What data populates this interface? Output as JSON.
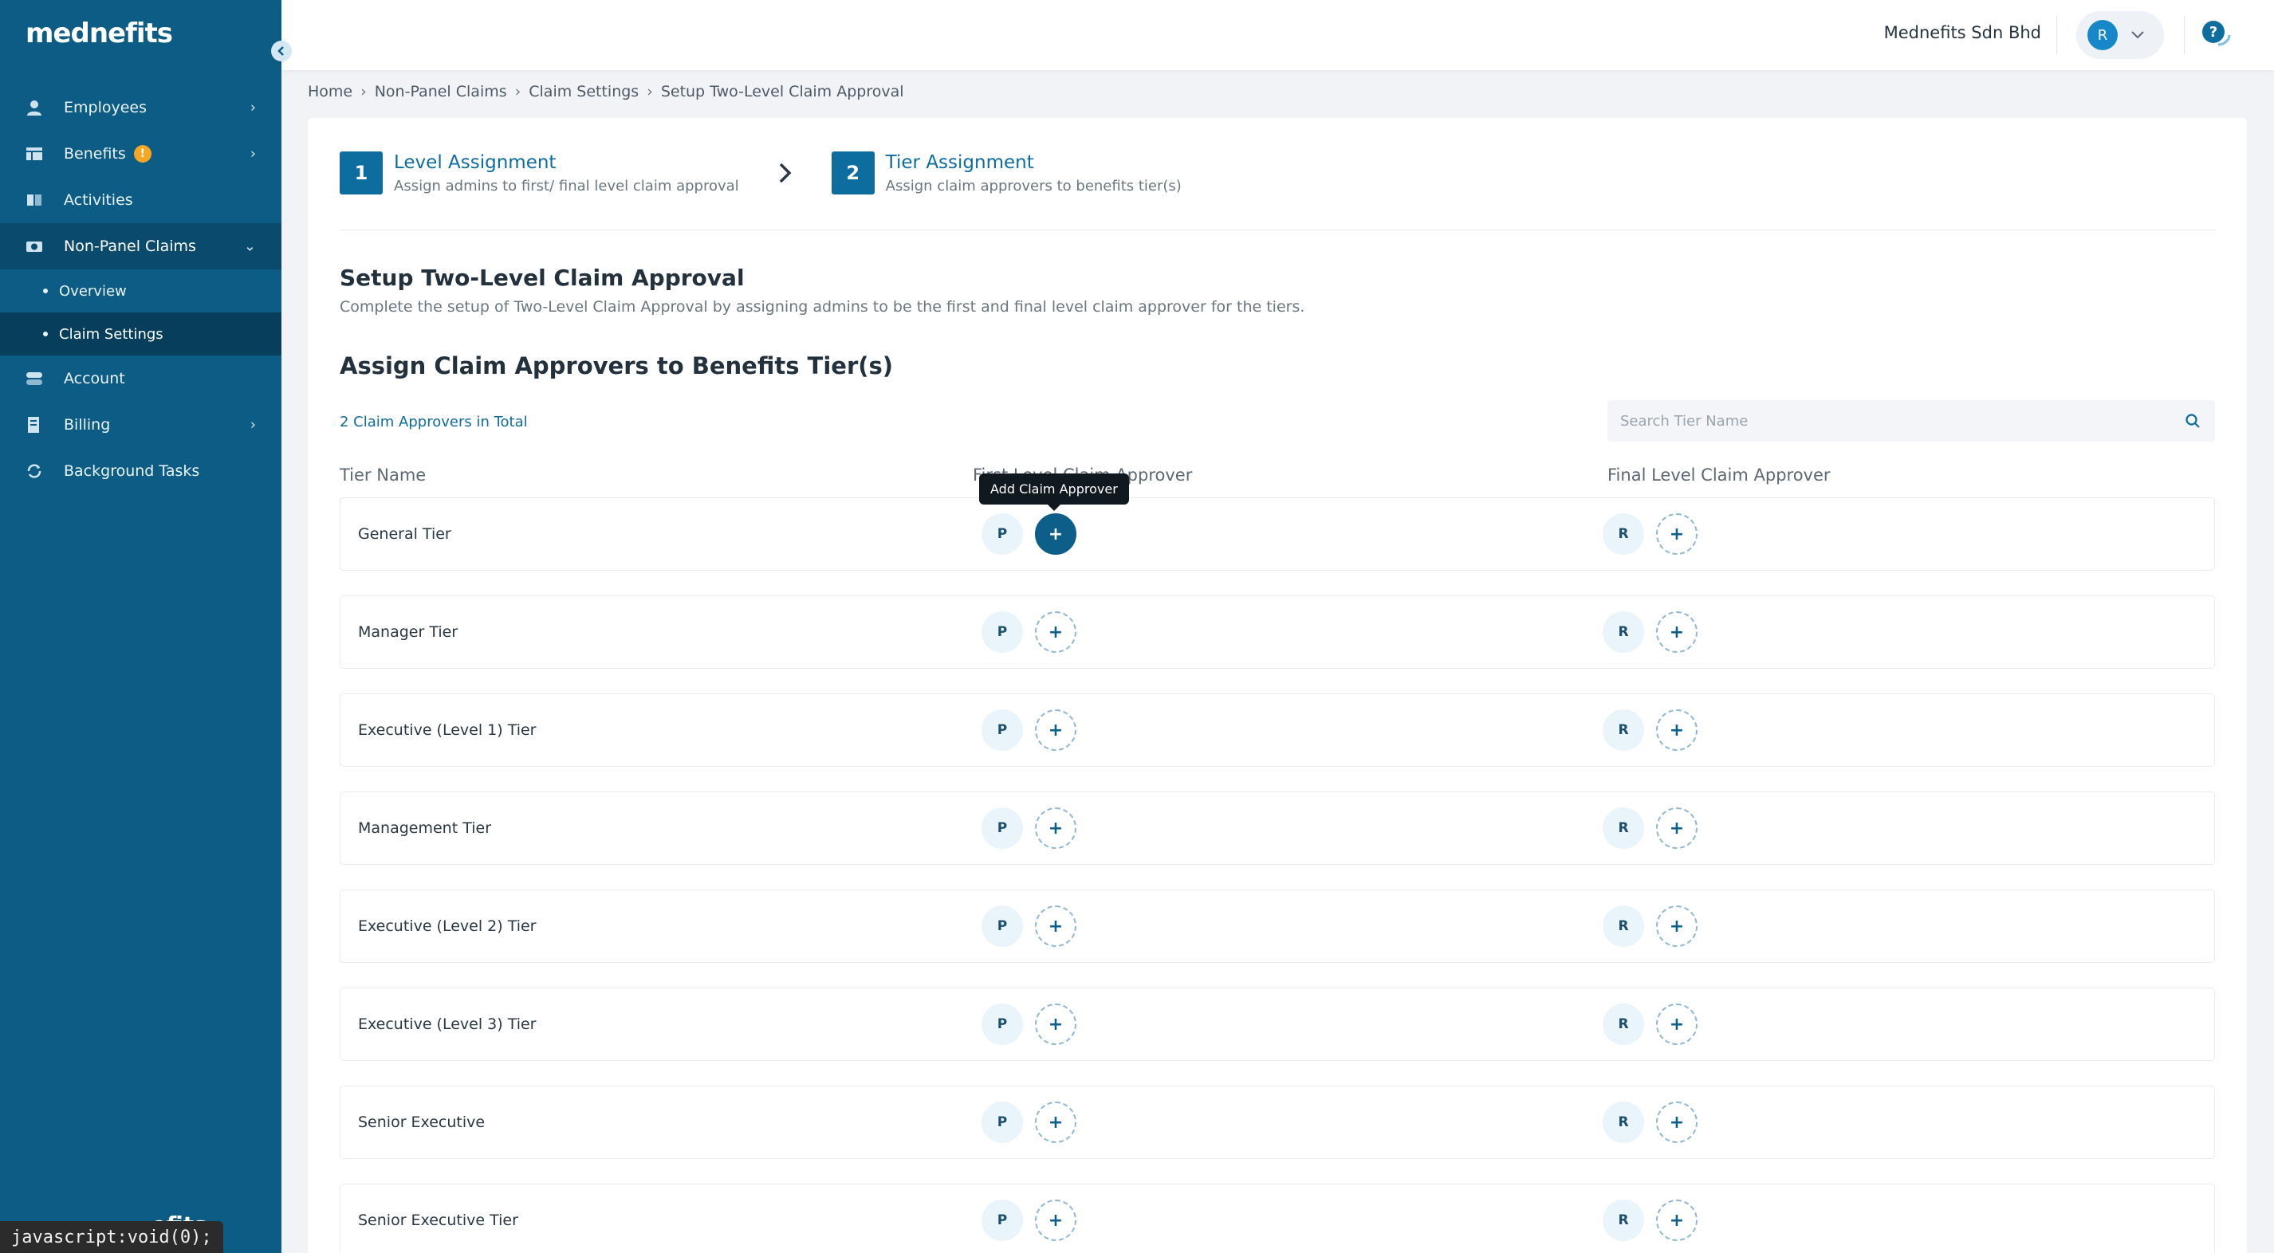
{
  "brand": {
    "logo": "mednefits"
  },
  "sidebar": {
    "items": [
      {
        "label": "Employees"
      },
      {
        "label": "Benefits",
        "badge": "!"
      },
      {
        "label": "Activities"
      },
      {
        "label": "Non-Panel Claims"
      },
      {
        "label": "Account"
      },
      {
        "label": "Billing"
      },
      {
        "label": "Background Tasks"
      }
    ],
    "sub_items": [
      {
        "label": "Overview"
      },
      {
        "label": "Claim Settings"
      }
    ],
    "footer_logo": "efits"
  },
  "status_bar": "javascript:void(0);",
  "header": {
    "company": "Mednefits Sdn Bhd",
    "avatar": "R"
  },
  "breadcrumb": [
    "Home",
    "Non-Panel Claims",
    "Claim Settings",
    "Setup Two-Level Claim Approval"
  ],
  "steps": [
    {
      "num": "1",
      "title": "Level Assignment",
      "desc": "Assign admins to first/ final level claim approval"
    },
    {
      "num": "2",
      "title": "Tier Assignment",
      "desc": "Assign claim approvers to benefits tier(s)"
    }
  ],
  "setup": {
    "title": "Setup Two-Level Claim Approval",
    "desc": "Complete the setup of Two-Level Claim Approval by assigning admins to be the first and final level claim approver for the tiers."
  },
  "assign": {
    "title": "Assign Claim Approvers to Benefits Tier(s)",
    "total": "2 Claim Approvers in Total",
    "search_placeholder": "Search Tier Name"
  },
  "table": {
    "headers": {
      "tier": "Tier Name",
      "first": "First Level Claim Approver",
      "final": "Final Level Claim Approver"
    },
    "tooltip": "Add Claim Approver",
    "add_symbol": "+",
    "rows": [
      {
        "name": "General Tier",
        "first": "P",
        "final": "R"
      },
      {
        "name": "Manager Tier",
        "first": "P",
        "final": "R"
      },
      {
        "name": "Executive (Level 1) Tier",
        "first": "P",
        "final": "R"
      },
      {
        "name": "Management Tier",
        "first": "P",
        "final": "R"
      },
      {
        "name": "Executive (Level 2) Tier",
        "first": "P",
        "final": "R"
      },
      {
        "name": "Executive (Level 3) Tier",
        "first": "P",
        "final": "R"
      },
      {
        "name": "Senior Executive",
        "first": "P",
        "final": "R"
      },
      {
        "name": "Senior Executive Tier",
        "first": "P",
        "final": "R"
      }
    ]
  }
}
